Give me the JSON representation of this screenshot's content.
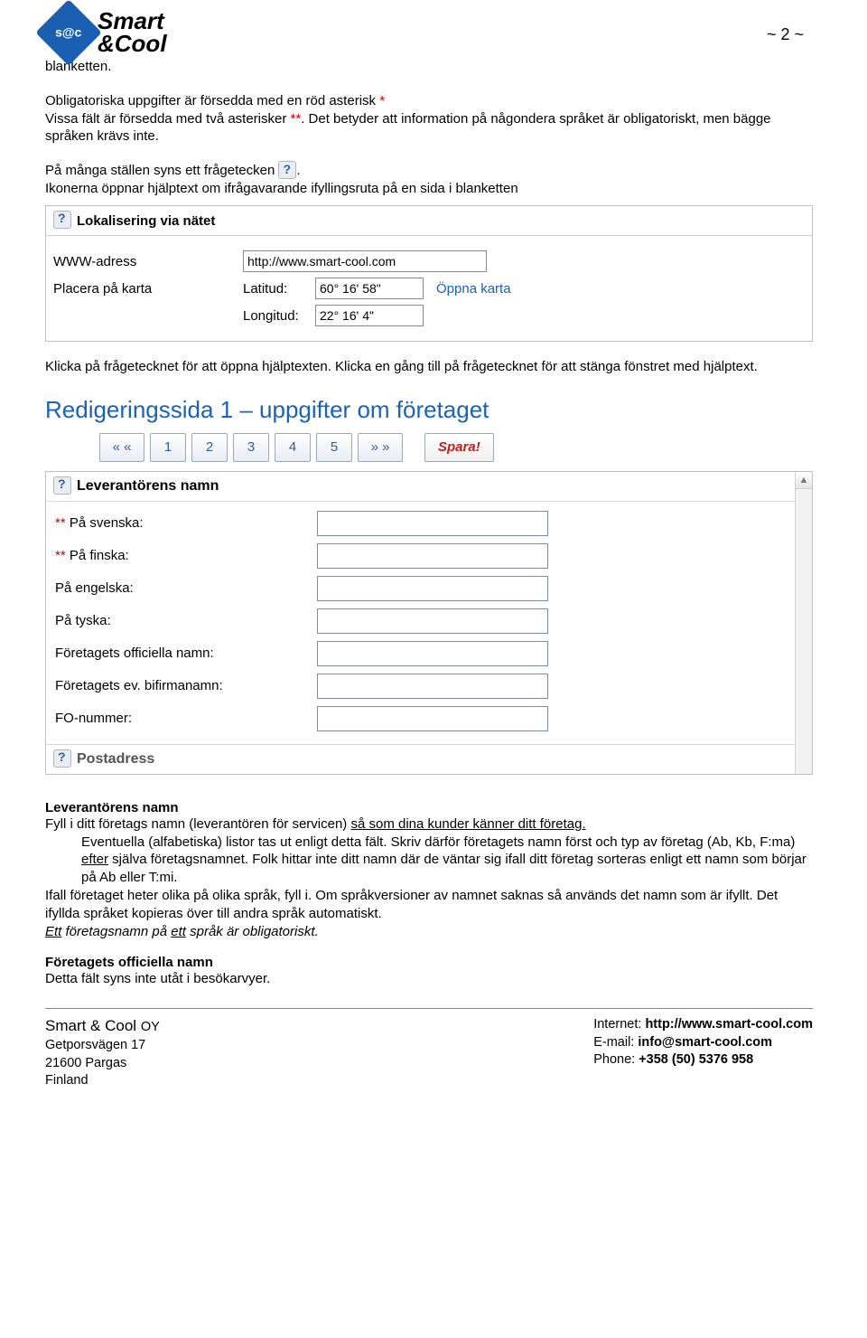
{
  "header": {
    "logo_abbr": "s@c",
    "logo_line1": "Smart",
    "logo_line2": "&Cool",
    "page_marker": "~ 2 ~"
  },
  "body": {
    "line0": "blanketten.",
    "p1a": "Obligatoriska uppgifter är försedda med en röd asterisk ",
    "p1star": "*",
    "p2a": "Vissa fält är försedda med två asterisker ",
    "p2star": "**",
    "p2b": ". Det betyder att information på någondera språket är obligatoriskt, men bägge språken krävs inte.",
    "p3a": "På många ställen syns ett frågetecken ",
    "p3b": ".",
    "p4": "Ikonerna öppnar hjälptext om ifrågavarande ifyllingsruta på en sida i blanketten"
  },
  "shot1": {
    "title": "Lokalisering via nätet",
    "www_label": "WWW-adress",
    "www_value": "http://www.smart-cool.com",
    "map_label": "Placera på karta",
    "lat_label": "Latitud:",
    "lat_value": "60° 16' 58\"",
    "open_map": "Öppna karta",
    "lon_label": "Longitud:",
    "lon_value": "22° 16' 4\""
  },
  "mid": {
    "p5": "Klicka på frågetecknet för att öppna hjälptexten. Klicka en gång till på frågetecknet för att stänga fönstret med hjälptext.",
    "h2": "Redigeringssida 1 – uppgifter om företaget"
  },
  "pager": {
    "first": "« «",
    "p1": "1",
    "p2": "2",
    "p3": "3",
    "p4": "4",
    "p5": "5",
    "last": "» »",
    "save": "Spara!"
  },
  "shot2": {
    "title": "Leverantörens namn",
    "r1star": "** ",
    "r1": "På svenska:",
    "r2star": "** ",
    "r2": "På finska:",
    "r3": "På engelska:",
    "r4": "På tyska:",
    "r5": "Företagets officiella namn:",
    "r6": "Företagets ev. bifirmanamn:",
    "r7": "FO-nummer:",
    "post": "Postadress"
  },
  "desc": {
    "t1": "Leverantörens namn",
    "p6a": "Fyll i ditt företags namn (leverantören för servicen) ",
    "p6u": "så som dina kunder känner ditt företag.",
    "p7a": "Eventuella (alfabetiska) listor tas ut enligt detta fält. Skriv därför företagets namn först och  typ av företag (Ab, Kb, F:ma) ",
    "p7u": "efter",
    "p7b": " själva företagsnamnet. Folk hittar inte ditt namn där de väntar sig ifall ditt företag sorteras enligt ett namn som börjar på Ab eller T:mi.",
    "p8": "Ifall företaget heter olika på olika språk, fyll i. Om språkversioner av namnet saknas så används det namn som är ifyllt. Det ifyllda språket kopieras över till andra språk automatiskt.",
    "p9u1": "Ett",
    "p9a": " företagsnamn på ",
    "p9u2": "ett",
    "p9b": " språk är obligatoriskt.",
    "t2": "Företagets officiella namn",
    "p10": "Detta fält syns inte utåt i besökarvyer."
  },
  "footer": {
    "company": "Smart & Cool ",
    "company_suffix": "OY",
    "addr1": "Getporsvägen 17",
    "addr2": "21600 Pargas",
    "addr3": "Finland",
    "net_l": "Internet: ",
    "net_v": "http://www.smart-cool.com",
    "mail_l": "E-mail: ",
    "mail_v": "info@smart-cool.com",
    "phone_l": "Phone: ",
    "phone_v": "+358 (50) 5376 958"
  }
}
